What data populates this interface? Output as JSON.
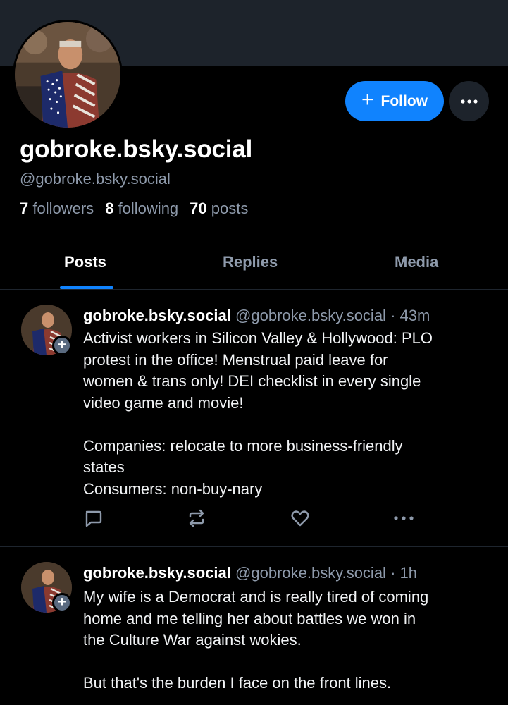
{
  "profile": {
    "display_name": "gobroke.bsky.social",
    "handle": "@gobroke.bsky.social",
    "followers_count": "7",
    "followers_label": "followers",
    "following_count": "8",
    "following_label": "following",
    "posts_count": "70",
    "posts_label": "posts",
    "follow_label": "Follow"
  },
  "tabs": [
    {
      "label": "Posts",
      "active": true
    },
    {
      "label": "Replies",
      "active": false
    },
    {
      "label": "Media",
      "active": false
    }
  ],
  "posts": [
    {
      "author": "gobroke.bsky.social",
      "handle": "@gobroke.bsky.social",
      "time": "· 43m",
      "lines": [
        "Activist workers in Silicon Valley & Hollywood:  PLO",
        "protest in the office!   Menstrual paid leave for",
        "women & trans only!  DEI checklist in every single",
        "video game and movie!",
        "",
        "Companies:  relocate to more business-friendly",
        "states",
        "Consumers:  non-buy-nary"
      ]
    },
    {
      "author": "gobroke.bsky.social",
      "handle": "@gobroke.bsky.social",
      "time": "· 1h",
      "lines": [
        "My wife is a Democrat and is really tired of coming",
        "home and me telling her about battles we won in",
        "the Culture War against wokies.",
        "",
        "But that's the burden I face on the front lines."
      ]
    }
  ],
  "colors": {
    "accent": "#1083fe",
    "banner": "#1d232b",
    "muted_text": "#8e9aab",
    "background": "#000000"
  },
  "icons": [
    "plus-icon",
    "more-horizontal-icon",
    "reply-icon",
    "repost-icon",
    "like-icon",
    "post-menu-icon"
  ]
}
